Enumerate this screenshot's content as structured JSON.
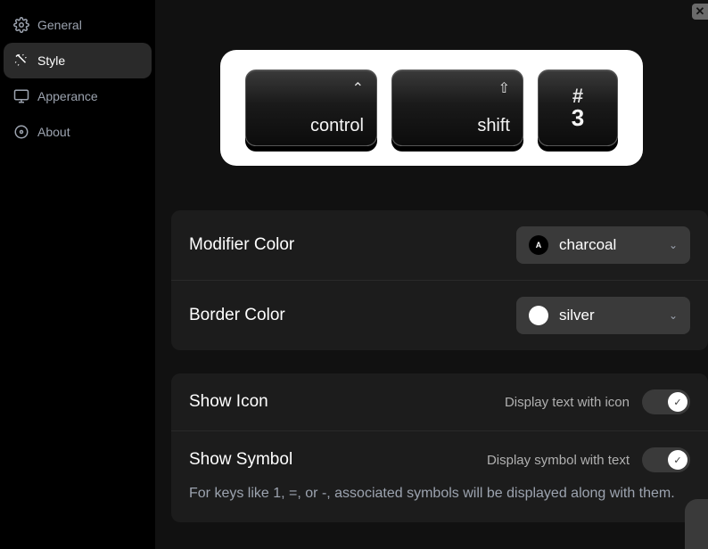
{
  "sidebar": {
    "items": [
      {
        "label": "General"
      },
      {
        "label": "Style"
      },
      {
        "label": "Apperance"
      },
      {
        "label": "About"
      }
    ]
  },
  "preview": {
    "keys": [
      {
        "symbol": "⌃",
        "label": "control"
      },
      {
        "symbol": "⇧",
        "label": "shift"
      },
      {
        "symbol": "#",
        "label": "3"
      }
    ]
  },
  "settings": {
    "modifier_color": {
      "label": "Modifier Color",
      "value": "charcoal",
      "swatch_letter": "A"
    },
    "border_color": {
      "label": "Border Color",
      "value": "silver"
    },
    "show_icon": {
      "label": "Show Icon",
      "sub": "Display text with icon"
    },
    "show_symbol": {
      "label": "Show Symbol",
      "sub": "Display symbol with text",
      "desc": "For keys like 1, =, or -, associated symbols will be displayed along with them."
    }
  }
}
